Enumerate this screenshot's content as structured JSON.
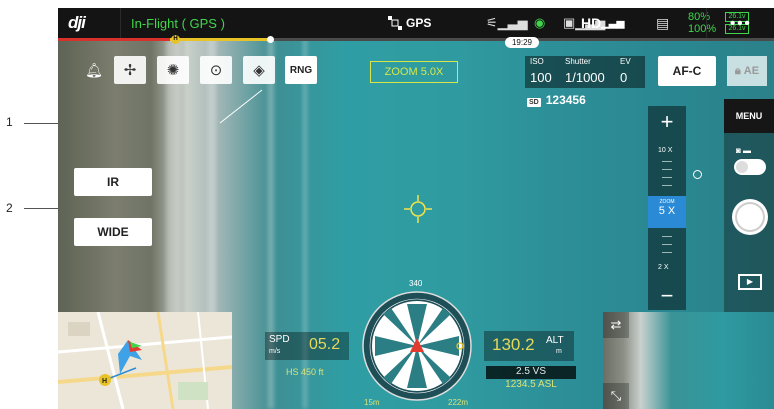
{
  "callouts": [
    {
      "number": "1"
    },
    {
      "number": "2"
    }
  ],
  "topbar": {
    "logo": "dji",
    "flight_status": "In-Flight ( GPS )",
    "gps_label": "GPS",
    "hd_label": "HD",
    "battery_aircraft": "80%",
    "battery_remote": "100%",
    "voltage_1": "26.1v",
    "voltage_2": "26.1v",
    "flight_time": "19:29",
    "more_label": "•••"
  },
  "toolbar": {
    "rng_label": "RNG"
  },
  "zoom_readout": "ZOOM 5.0X",
  "exposure": {
    "iso_label": "ISO",
    "iso_value": "100",
    "shutter_label": "Shutter",
    "shutter_value": "1/1000",
    "ev_label": "EV",
    "ev_value": "0"
  },
  "focus_mode": "AF-C",
  "ae_label": "AE",
  "sd_badge": "SD",
  "sd_capacity": "123456",
  "zoom_slider": {
    "plus": "+",
    "minus": "−",
    "max_label": "10 X",
    "current_small": "ZOOM",
    "current": "5 X",
    "min_label": "2 X",
    "level": 0.375
  },
  "sidebar": {
    "menu_label": "MENU"
  },
  "left_buttons": {
    "ir_label": "IR",
    "wide_label": "WIDE"
  },
  "telemetry": {
    "spd_label": "SPD",
    "spd_unit": "m/s",
    "spd_value": "05.2",
    "hs_label": "HS 450 ft",
    "alt_value": "130.2",
    "alt_label": "ALT",
    "alt_unit": "m",
    "vs": "2.5 VS",
    "asl": "1234.5 ASL",
    "distance_left": "15m",
    "distance_right": "222m"
  },
  "compass": {
    "heading": "340"
  },
  "colors": {
    "status_green": "#3fd64b",
    "zoom_yellow": "#d7e64b",
    "zoom_selected": "#2b8ad6",
    "timeline_red": "#d8302a",
    "timeline_yellow": "#e7c327"
  }
}
